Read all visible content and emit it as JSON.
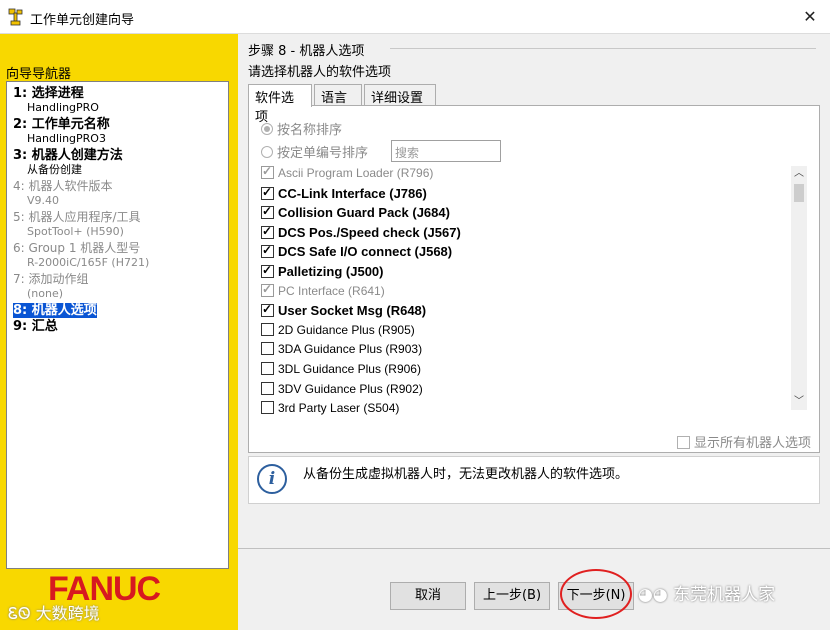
{
  "window": {
    "title": "工作单元创建向导",
    "close_glyph": "✕"
  },
  "navigator": {
    "title": "向导导航器",
    "items": [
      {
        "label": "1: 选择进程",
        "sub": "HandlingPRO",
        "state": "done"
      },
      {
        "label": "2: 工作单元名称",
        "sub": "HandlingPRO3",
        "state": "done"
      },
      {
        "label": "3: 机器人创建方法",
        "sub": "从备份创建",
        "state": "done"
      },
      {
        "label": "4: 机器人软件版本",
        "sub": "V9.40",
        "state": "disabled"
      },
      {
        "label": "5: 机器人应用程序/工具",
        "sub": "SpotTool+ (H590)",
        "state": "disabled"
      },
      {
        "label": "6: Group 1 机器人型号",
        "sub": "R-2000iC/165F (H721)",
        "state": "disabled"
      },
      {
        "label": "7: 添加动作组",
        "sub": "(none)",
        "state": "disabled"
      },
      {
        "label": "8: 机器人选项",
        "sub": "",
        "state": "selected"
      },
      {
        "label": "9: 汇总",
        "sub": "",
        "state": "todo"
      }
    ],
    "logo": "FANUC",
    "watermark": "大数跨境"
  },
  "step": {
    "title": "步骤 8 - 机器人选项",
    "description": "请选择机器人的软件选项"
  },
  "tabs": [
    {
      "label": "软件选项",
      "active": true
    },
    {
      "label": "语言",
      "active": false
    },
    {
      "label": "详细设置",
      "active": false
    }
  ],
  "sort": {
    "by_name": "按名称排序",
    "by_order": "按定单编号排序",
    "selected": "by_name",
    "search_placeholder": "搜索"
  },
  "options": [
    {
      "label": "Ascii Program Loader (R796)",
      "checked": true,
      "style": "gray"
    },
    {
      "label": "CC-Link Interface (J786)",
      "checked": true,
      "style": "bold"
    },
    {
      "label": "Collision Guard Pack (J684)",
      "checked": true,
      "style": "bold"
    },
    {
      "label": "DCS Pos./Speed check (J567)",
      "checked": true,
      "style": "bold"
    },
    {
      "label": "DCS Safe I/O connect (J568)",
      "checked": true,
      "style": "bold"
    },
    {
      "label": "Palletizing (J500)",
      "checked": true,
      "style": "bold"
    },
    {
      "label": "PC Interface (R641)",
      "checked": true,
      "style": "gray"
    },
    {
      "label": "User Socket Msg (R648)",
      "checked": true,
      "style": "bold"
    },
    {
      "label": "2D Guidance Plus (R905)",
      "checked": false,
      "style": "normal"
    },
    {
      "label": "3DA Guidance Plus (R903)",
      "checked": false,
      "style": "normal"
    },
    {
      "label": "3DL Guidance Plus (R906)",
      "checked": false,
      "style": "normal"
    },
    {
      "label": "3DV Guidance Plus (R902)",
      "checked": false,
      "style": "normal"
    },
    {
      "label": "3rd Party Laser (S504)",
      "checked": false,
      "style": "normal"
    }
  ],
  "show_all_label": "显示所有机器人选项",
  "info": {
    "icon": "info-icon",
    "text": "从备份生成虚拟机器人时，无法更改机器人的软件选项。"
  },
  "buttons": {
    "cancel": "取消",
    "back": "上一步(B)",
    "next": "下一步(N)"
  },
  "watermark_right": "东莞机器人家",
  "colors": {
    "nav_background": "#f8d800",
    "selection": "#0a55d4",
    "logo": "#d71920",
    "highlight_circle": "#e02020"
  }
}
